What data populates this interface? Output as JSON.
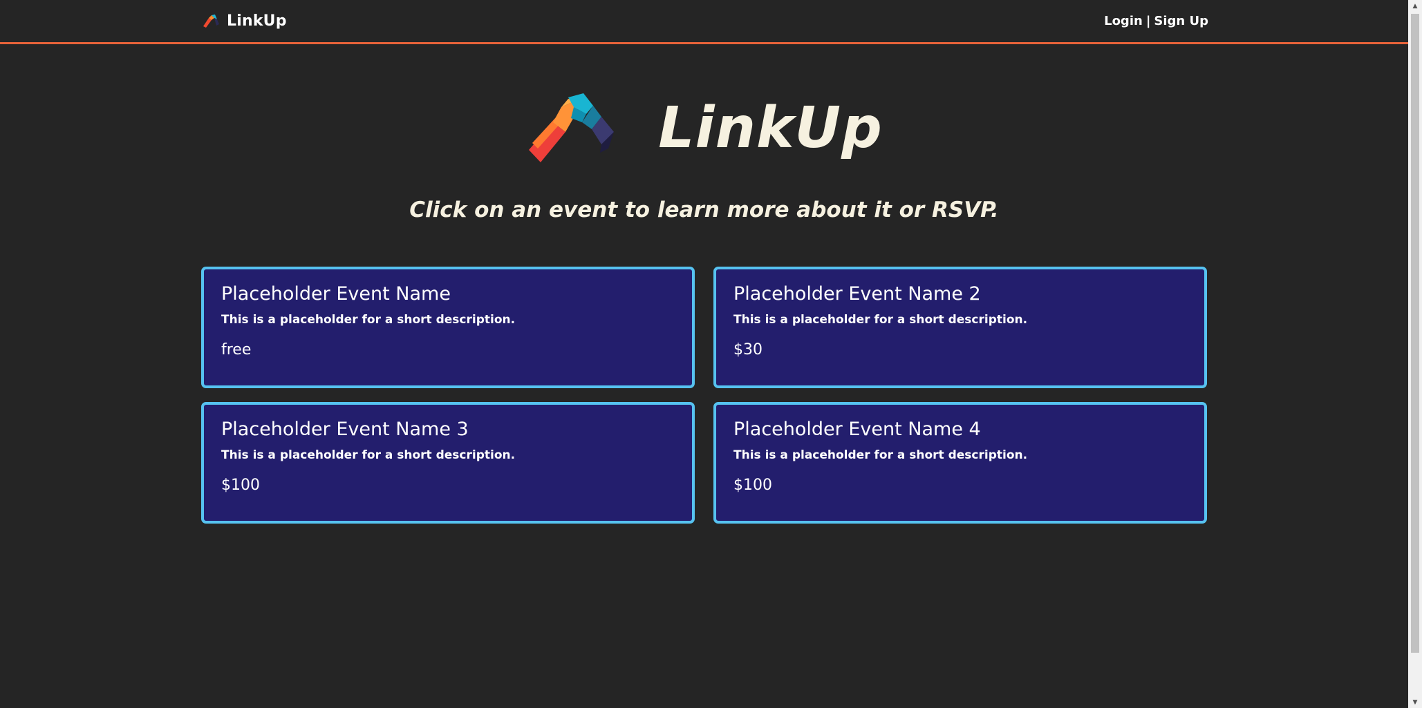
{
  "navbar": {
    "brand": "LinkUp",
    "brand_icon": "linkup-logo-icon",
    "login_label": "Login",
    "separator": "|",
    "signup_label": "Sign Up",
    "accent_color": "#e8633a"
  },
  "hero": {
    "title": "LinkUp",
    "logo_icon": "linkup-handshake-logo"
  },
  "instruction": "Click on an event to learn more about it or RSVP.",
  "events": [
    {
      "name": "Placeholder Event Name",
      "description": "This is a placeholder for a short description.",
      "price": "free"
    },
    {
      "name": "Placeholder Event Name 2",
      "description": "This is a placeholder for a short description.",
      "price": "$30"
    },
    {
      "name": "Placeholder Event Name 3",
      "description": "This is a placeholder for a short description.",
      "price": "$100"
    },
    {
      "name": "Placeholder Event Name 4",
      "description": "This is a placeholder for a short description.",
      "price": "$100"
    }
  ],
  "colors": {
    "background": "#252525",
    "card_background": "#231e6d",
    "card_border": "#56c2f0",
    "title_text": "#f6f1e0"
  }
}
